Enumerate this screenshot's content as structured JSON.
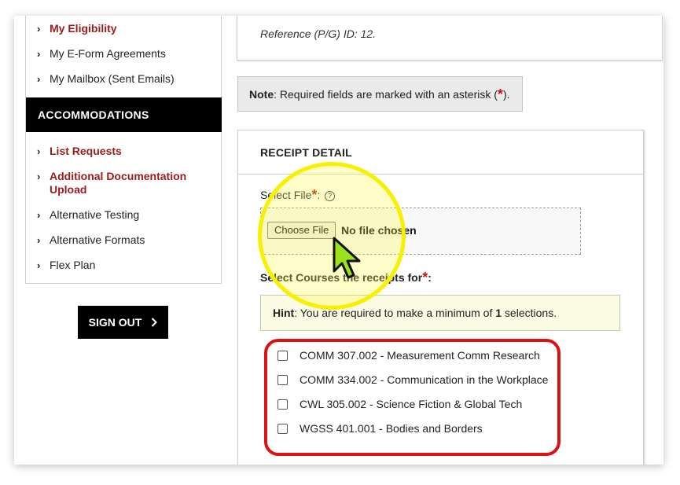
{
  "sidebar": {
    "items_top": [
      {
        "label": "My Eligibility",
        "active": true
      },
      {
        "label": "My E-Form Agreements",
        "active": false
      },
      {
        "label": "My Mailbox (Sent Emails)",
        "active": false
      }
    ],
    "section_title": "ACCOMMODATIONS",
    "items_accommodations": [
      {
        "label": "List Requests",
        "active": true
      },
      {
        "label": "Additional Documentation Upload",
        "active": true
      },
      {
        "label": "Alternative Testing",
        "active": false
      },
      {
        "label": "Alternative Formats",
        "active": false
      },
      {
        "label": "Flex Plan",
        "active": false
      }
    ],
    "sign_out_label": "SIGN OUT"
  },
  "main": {
    "reference_text": "Reference (P/G) ID: 12.",
    "note": {
      "prefix": "Note",
      "text_before": ": Required fields are marked with an asterisk (",
      "star": "*",
      "text_after": ")."
    },
    "receipt": {
      "title": "RECEIPT DETAIL",
      "select_file_label": "Select File",
      "required_star": "*",
      "colon": ":",
      "help_glyph": "?",
      "choose_file_button": "Choose File",
      "no_file_text": "No file chosen",
      "select_courses_label": "Select Courses the receipts for",
      "hint": {
        "prefix": "Hint",
        "text_before": ": You are required to make a minimum of ",
        "count": "1",
        "text_after": " selections."
      },
      "courses": [
        {
          "label": "COMM 307.002 - Measurement Comm Research",
          "checked": false
        },
        {
          "label": "COMM 334.002 - Communication in the Workplace",
          "checked": false
        },
        {
          "label": "CWL 305.002 - Science Fiction & Global Tech",
          "checked": false
        },
        {
          "label": "WGSS 401.001 - Bodies and Borders",
          "checked": false
        }
      ]
    }
  },
  "colors": {
    "accent_red": "#9b1b1b",
    "required_red": "#d10f0f",
    "highlight_yellow": "#f7f000",
    "outline_red": "#dd1111",
    "cursor_green": "#9be21a"
  }
}
